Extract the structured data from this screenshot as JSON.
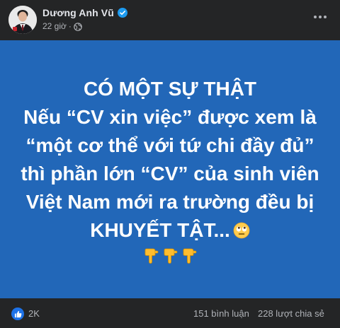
{
  "post": {
    "author": {
      "name": "Dương Anh Vũ",
      "verified": true,
      "avatar_icon": "profile-photo"
    },
    "meta": {
      "time": "22 giờ",
      "separator": "·",
      "privacy_icon": "globe-icon"
    },
    "more_icon": "more-horizontal-icon",
    "background_color": "#2267b8",
    "text_lines": [
      "CÓ MỘT SỰ THẬT",
      "Nếu “CV xin việc” được xem là",
      "“một cơ thể với tứ chi đầy đủ”",
      "thì phần lớn “CV” của sinh viên",
      "Việt Nam mới ra trường đều bị",
      "KHUYẾT TẬT..."
    ],
    "emojis": [
      "rolling-eyes-face",
      "backhand-index-pointing-down",
      "backhand-index-pointing-down",
      "backhand-index-pointing-down"
    ]
  },
  "stats": {
    "reaction_icon": "like-icon",
    "reactions": "2K",
    "comments": "151 bình luận",
    "shares": "228 lượt chia sẻ"
  },
  "colors": {
    "page_bg": "#242526",
    "text_primary": "#e4e6eb",
    "text_secondary": "#b0b3b8",
    "verified_blue": "#1d9bf0",
    "like_blue": "#1d72e8"
  }
}
